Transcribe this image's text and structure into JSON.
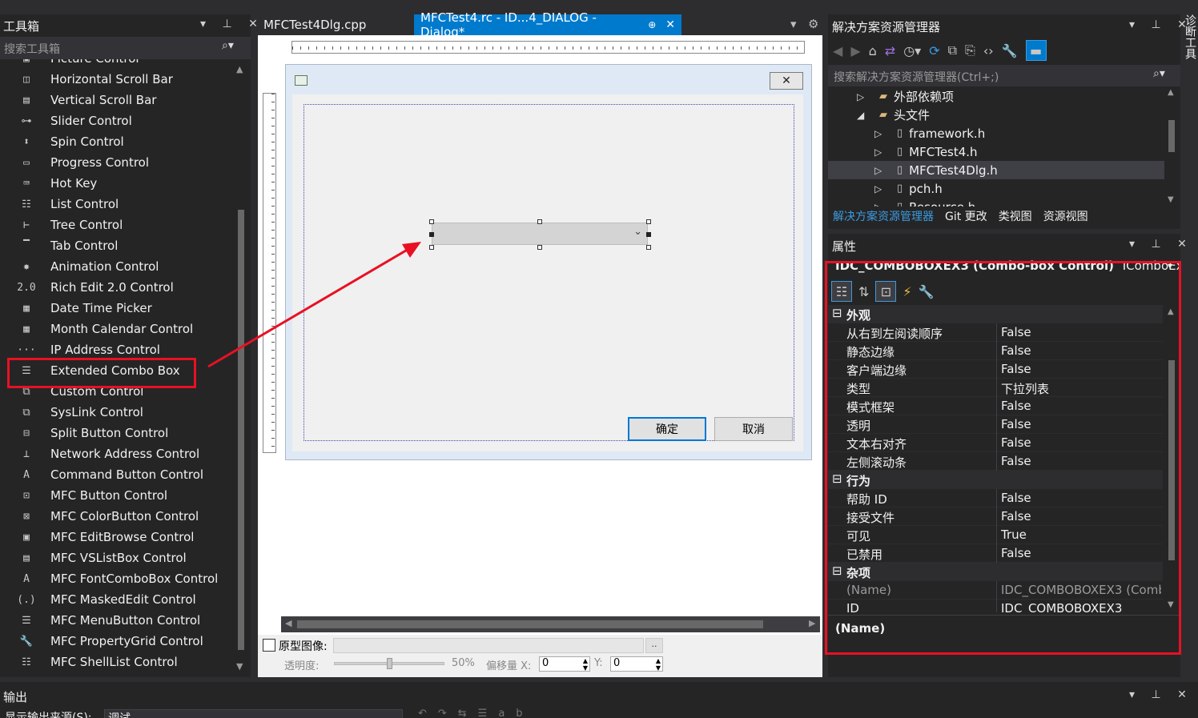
{
  "toolbox": {
    "title": "工具箱",
    "search_placeholder": "搜索工具箱",
    "partial_top_item": "Picture Control",
    "items": [
      {
        "label": "Horizontal Scroll Bar",
        "icon": "◫"
      },
      {
        "label": "Vertical Scroll Bar",
        "icon": "▤"
      },
      {
        "label": "Slider Control",
        "icon": "⊶"
      },
      {
        "label": "Spin Control",
        "icon": "⬍"
      },
      {
        "label": "Progress Control",
        "icon": "▭"
      },
      {
        "label": "Hot Key",
        "icon": "⌨"
      },
      {
        "label": "List Control",
        "icon": "☷"
      },
      {
        "label": "Tree Control",
        "icon": "⊢"
      },
      {
        "label": "Tab Control",
        "icon": "▔"
      },
      {
        "label": "Animation Control",
        "icon": "✸"
      },
      {
        "label": "Rich Edit 2.0 Control",
        "icon": "2.0"
      },
      {
        "label": "Date Time Picker",
        "icon": "▦"
      },
      {
        "label": "Month Calendar Control",
        "icon": "▦"
      },
      {
        "label": "IP Address Control",
        "icon": "···"
      },
      {
        "label": "Extended Combo Box",
        "icon": "☰"
      },
      {
        "label": "Custom Control",
        "icon": "⧉"
      },
      {
        "label": "SysLink Control",
        "icon": "⧉"
      },
      {
        "label": "Split Button Control",
        "icon": "⊟"
      },
      {
        "label": "Network Address Control",
        "icon": "⊥"
      },
      {
        "label": "Command Button Control",
        "icon": "A"
      },
      {
        "label": "MFC Button Control",
        "icon": "⊡"
      },
      {
        "label": "MFC ColorButton Control",
        "icon": "⊠"
      },
      {
        "label": "MFC EditBrowse Control",
        "icon": "▣"
      },
      {
        "label": "MFC VSListBox Control",
        "icon": "▤"
      },
      {
        "label": "MFC FontComboBox Control",
        "icon": "A"
      },
      {
        "label": "MFC MaskedEdit Control",
        "icon": "(.)"
      },
      {
        "label": "MFC MenuButton Control",
        "icon": "☰"
      },
      {
        "label": "MFC PropertyGrid Control",
        "icon": "🔧"
      },
      {
        "label": "MFC ShellList Control",
        "icon": "☷"
      }
    ]
  },
  "editor": {
    "tabs": [
      {
        "label": "MFCTest4Dlg.cpp",
        "active": false
      },
      {
        "label": "MFCTest4.rc - ID...4_DIALOG - Dialog*",
        "active": true
      }
    ],
    "dialog": {
      "ok_label": "确定",
      "cancel_label": "取消"
    },
    "bottom": {
      "prototype_label": "原型图像:",
      "browse_label": "..",
      "opacity_label": "透明度:",
      "opacity_value": "50%",
      "opacity_fraction": 0.5,
      "offset_label": "偏移量 X:",
      "x_value": "0",
      "y_label": "Y:",
      "y_value": "0"
    }
  },
  "solution": {
    "title": "解决方案资源管理器",
    "search_placeholder": "搜索解决方案资源管理器(Ctrl+;)",
    "items": [
      {
        "label": "外部依赖项",
        "indent": 1,
        "expanded": false,
        "selected": false
      },
      {
        "label": "头文件",
        "indent": 1,
        "expanded": true,
        "selected": false
      },
      {
        "label": "framework.h",
        "indent": 2,
        "expanded": false,
        "selected": false
      },
      {
        "label": "MFCTest4.h",
        "indent": 2,
        "expanded": false,
        "selected": false
      },
      {
        "label": "MFCTest4Dlg.h",
        "indent": 2,
        "expanded": false,
        "selected": true
      },
      {
        "label": "pch.h",
        "indent": 2,
        "expanded": false,
        "selected": false
      },
      {
        "label": "Resource.h",
        "indent": 2,
        "expanded": false,
        "selected": false
      }
    ],
    "tabs": [
      "解决方案资源管理器",
      "Git 更改",
      "类视图",
      "资源视图"
    ]
  },
  "properties": {
    "title": "属性",
    "object": "IDC_COMBOBOXEX3 (Combo-box Control)",
    "object_type": "IComboExt",
    "categories": [
      {
        "name": "外观",
        "rows": [
          {
            "k": "从右到左阅读顺序",
            "v": "False"
          },
          {
            "k": "静态边缘",
            "v": "False"
          },
          {
            "k": "客户端边缘",
            "v": "False"
          },
          {
            "k": "类型",
            "v": "下拉列表"
          },
          {
            "k": "模式框架",
            "v": "False"
          },
          {
            "k": "透明",
            "v": "False"
          },
          {
            "k": "文本右对齐",
            "v": "False"
          },
          {
            "k": "左侧滚动条",
            "v": "False"
          }
        ]
      },
      {
        "name": "行为",
        "rows": [
          {
            "k": "帮助 ID",
            "v": "False"
          },
          {
            "k": "接受文件",
            "v": "False"
          },
          {
            "k": "可见",
            "v": "True"
          },
          {
            "k": "已禁用",
            "v": "False"
          }
        ]
      },
      {
        "name": "杂项",
        "rows": [
          {
            "k": "(Name)",
            "v": "IDC_COMBOBOXEX3 (Comb"
          },
          {
            "k": "ID",
            "v": "IDC_COMBOBOXEX3"
          }
        ]
      }
    ],
    "description_title": "(Name)"
  },
  "output": {
    "title": "输出",
    "source_label": "显示输出来源(S):",
    "source_value": "调试"
  },
  "right_edge_label": "诊断工具",
  "colors": {
    "accent": "#007acc",
    "highlight_red": "#e81123",
    "selection": "#3f3f46"
  }
}
